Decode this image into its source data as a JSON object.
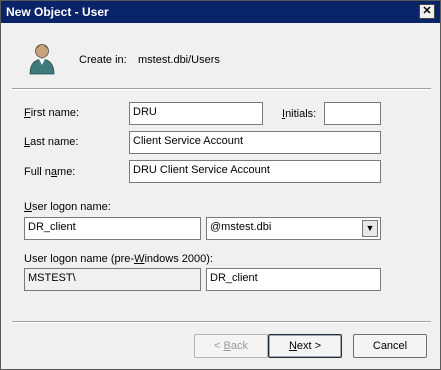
{
  "window": {
    "title": "New Object - User",
    "close_glyph": "✕"
  },
  "header": {
    "create_in_label": "Create in:",
    "create_in_path": "mstest.dbi/Users",
    "icon": "user-icon"
  },
  "form": {
    "first_name": {
      "label_accel": "F",
      "label_rest": "irst name:",
      "value": "DRU"
    },
    "initials": {
      "label_accel": "I",
      "label_rest": "nitials:",
      "value": ""
    },
    "last_name": {
      "label_accel": "L",
      "label_rest": "ast name:",
      "value": "Client Service Account"
    },
    "full_name": {
      "label_pre": "Full n",
      "label_accel": "a",
      "label_rest": "me:",
      "value": "DRU Client Service Account"
    },
    "logon": {
      "label_pre": "",
      "label_accel": "U",
      "label_rest": "ser logon name:",
      "value": "DR_client",
      "domain": "@mstest.dbi"
    },
    "pre2000": {
      "label_pre": "User logon name (pre-",
      "label_accel": "W",
      "label_rest": "indows 2000):",
      "prefix": "MSTEST\\",
      "value": "DR_client"
    }
  },
  "buttons": {
    "back": {
      "pre": "< ",
      "accel": "B",
      "rest": "ack"
    },
    "next": {
      "accel": "N",
      "rest": "ext >"
    },
    "cancel": "Cancel"
  }
}
